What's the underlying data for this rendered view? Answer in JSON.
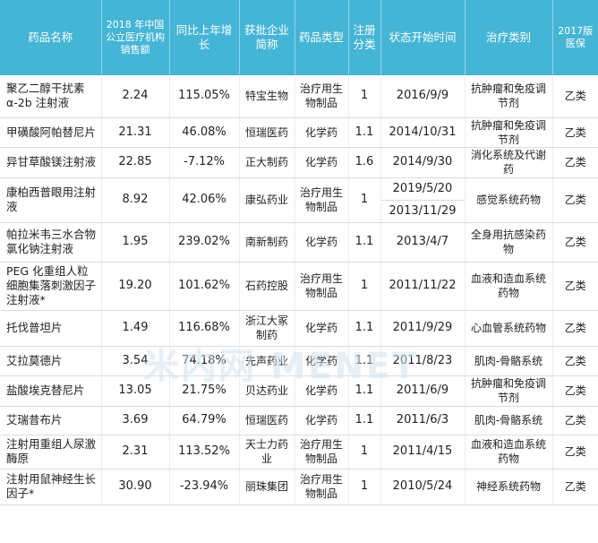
{
  "header": {
    "name": "药品名称",
    "sales": "2018 年中国公立医疗机构销售额",
    "growth": "同比上年增长",
    "company": "获批企业简称",
    "type": "药品类型",
    "reg": "注册分类",
    "date": "状态开始时间",
    "category": "治疗类别",
    "insurance": "2017版医保"
  },
  "rows": [
    {
      "name": "聚乙二醇干扰素α-2b 注射液",
      "sales": "2.24",
      "growth": "115.05%",
      "company": "特宝生物",
      "type": "治疗用生物制品",
      "reg": "1",
      "date": "2016/9/9",
      "category": "抗肿瘤和免疫调节剂",
      "insurance": "乙类"
    },
    {
      "name": "甲磺酸阿帕替尼片",
      "sales": "21.31",
      "growth": "46.08%",
      "company": "恒瑞医药",
      "type": "化学药",
      "reg": "1.1",
      "date": "2014/10/31",
      "category": "抗肿瘤和免疫调节剂",
      "insurance": "乙类"
    },
    {
      "name": "异甘草酸镁注射液",
      "sales": "22.85",
      "growth": "-7.12%",
      "company": "正大制药",
      "type": "化学药",
      "reg": "1.6",
      "date": "2014/9/30",
      "category": "消化系统及代谢药",
      "insurance": "乙类"
    },
    {
      "name": "康柏西普眼用注射液",
      "sales": "8.92",
      "growth": "42.06%",
      "company": "康弘药业",
      "type": "治疗用生物制品",
      "reg": "1",
      "date": "2019/5/20",
      "date2": "2013/11/29",
      "category": "感觉系统药物",
      "insurance": "乙类"
    },
    {
      "name": "帕拉米韦三水合物氯化钠注射液",
      "sales": "1.95",
      "growth": "239.02%",
      "company": "南新制药",
      "type": "化学药",
      "reg": "1.1",
      "date": "2013/4/7",
      "category": "全身用抗感染药物",
      "insurance": "乙类"
    },
    {
      "name": "PEG 化重组人粒细胞集落刺激因子注射液*",
      "sales": "19.20",
      "growth": "101.62%",
      "company": "石药控股",
      "type": "治疗用生物制品",
      "reg": "1",
      "date": "2011/11/22",
      "category": "血液和造血系统药物",
      "insurance": "乙类"
    },
    {
      "name": "托伐普坦片",
      "sales": "1.49",
      "growth": "116.68%",
      "company": "浙江大冢制药",
      "type": "化学药",
      "reg": "1.1",
      "date": "2011/9/29",
      "category": "心血管系统药物",
      "insurance": "乙类"
    },
    {
      "name": "艾拉莫德片",
      "sales": "3.54",
      "growth": "74.18%",
      "company": "先声药业",
      "type": "化学药",
      "reg": "1.1",
      "date": "2011/8/23",
      "category": "肌肉-骨骼系统",
      "insurance": "乙类"
    },
    {
      "name": "盐酸埃克替尼片",
      "sales": "13.05",
      "growth": "21.75%",
      "company": "贝达药业",
      "type": "化学药",
      "reg": "1.1",
      "date": "2011/6/9",
      "category": "抗肿瘤和免疫调节剂",
      "insurance": "乙类"
    },
    {
      "name": "艾瑞昔布片",
      "sales": "3.69",
      "growth": "64.79%",
      "company": "恒瑞医药",
      "type": "化学药",
      "reg": "1.1",
      "date": "2011/6/3",
      "category": "肌肉-骨骼系统",
      "insurance": "乙类"
    },
    {
      "name": "注射用重组人尿激酶原",
      "sales": "2.31",
      "growth": "113.52%",
      "company": "天士力药业",
      "type": "治疗用生物制品",
      "reg": "1",
      "date": "2011/4/15",
      "category": "血液和造血系统药物",
      "insurance": "乙类"
    },
    {
      "name": "注射用鼠神经生长因子*",
      "sales": "30.90",
      "growth": "-23.94%",
      "company": "丽珠集团",
      "type": "治疗用生物制品",
      "reg": "1",
      "date": "2010/5/24",
      "category": "神经系统药物",
      "insurance": "乙类"
    }
  ],
  "watermark": "米内网 MENET",
  "colors": {
    "header_bg": "#45b5d6",
    "header_text": "#ffffff",
    "row_border": "#dcdcdc"
  }
}
